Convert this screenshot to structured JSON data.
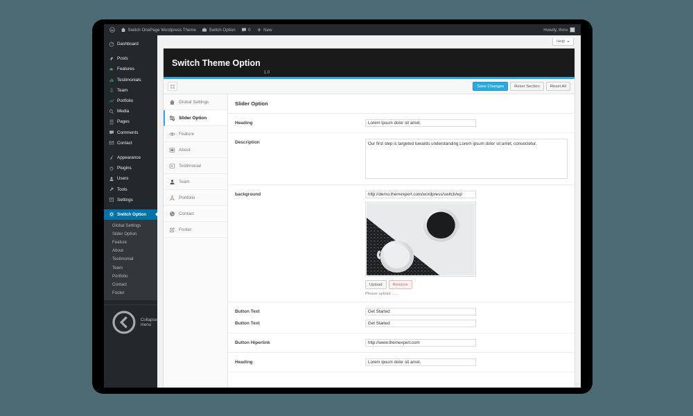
{
  "adminbar": {
    "wp_logo": "wordpress-logo-icon",
    "site_name": "Switch OnePage Wordpress Theme",
    "site_icon": "home-icon",
    "plugin_name": "Switch Option",
    "plugin_icon": "suitcase-icon",
    "comments_icon": "comment-bubble-icon",
    "comments_count": "0",
    "new_label": "New",
    "new_icon": "plus-icon",
    "howdy": "Howdy, thmx",
    "avatar": "user-avatar"
  },
  "adminmenu": {
    "items": [
      {
        "label": "Dashboard",
        "icon": "dashboard-icon",
        "accent": "grey"
      },
      {
        "label": "Posts",
        "icon": "pin-icon",
        "accent": "grey"
      },
      {
        "label": "Features",
        "icon": "cloud-icon",
        "accent": "green"
      },
      {
        "label": "Testimonials",
        "icon": "chart-icon",
        "accent": "green"
      },
      {
        "label": "Team",
        "icon": "anchor-icon",
        "accent": "green"
      },
      {
        "label": "Portfolio",
        "icon": "zigzag-icon",
        "accent": "green"
      },
      {
        "label": "Media",
        "icon": "camera-icon",
        "accent": "grey"
      },
      {
        "label": "Pages",
        "icon": "page-icon",
        "accent": "grey"
      },
      {
        "label": "Comments",
        "icon": "comment-bubble-icon",
        "accent": "grey"
      },
      {
        "label": "Contact",
        "icon": "envelope-icon",
        "accent": "grey"
      },
      {
        "label": "Appearance",
        "icon": "brush-icon",
        "accent": "grey"
      },
      {
        "label": "Plugins",
        "icon": "plug-icon",
        "accent": "grey"
      },
      {
        "label": "Users",
        "icon": "user-icon",
        "accent": "grey"
      },
      {
        "label": "Tools",
        "icon": "wrench-icon",
        "accent": "grey"
      },
      {
        "label": "Settings",
        "icon": "sliders-icon",
        "accent": "grey"
      }
    ],
    "current": {
      "label": "Switch Option",
      "icon": "gear-icon"
    },
    "submenu": [
      "Global Settings",
      "Slider Option",
      "Feature",
      "About",
      "Testimonial",
      "Team",
      "Portfolio",
      "Contact",
      "Footer"
    ],
    "collapse": {
      "label": "Collapse menu",
      "icon": "collapse-icon"
    }
  },
  "help": {
    "label": "Help",
    "icon": "chevron-down-icon"
  },
  "panel": {
    "title": "Switch Theme Option",
    "version": "1.0",
    "accent_color": "#29abe2",
    "menu_toggle_icon": "grid-toggle-icon",
    "buttons": {
      "save": "Save Changes",
      "reset_section": "Reset Section",
      "reset_all": "Reset All"
    }
  },
  "option_tabs": [
    {
      "label": "Global Settings",
      "icon": "home-icon",
      "active": false
    },
    {
      "label": "Slider Option",
      "icon": "sliders-icon",
      "active": true
    },
    {
      "label": "Feature",
      "icon": "eye-icon",
      "active": false
    },
    {
      "label": "About",
      "icon": "card-icon",
      "active": false
    },
    {
      "label": "Testimonial",
      "icon": "quote-list-icon",
      "active": false
    },
    {
      "label": "Team",
      "icon": "user-icon",
      "active": false
    },
    {
      "label": "Portfolio",
      "icon": "compass-icon",
      "active": false
    },
    {
      "label": "Contact",
      "icon": "phone-icon",
      "active": false
    },
    {
      "label": "Footer",
      "icon": "edit-square-icon",
      "active": false
    }
  ],
  "form": {
    "section_title": "Slider Option",
    "heading_label": "Heading",
    "heading_value": "Lorem ipsum dolor sit amet.",
    "description_label": "Description",
    "description_value": "Our first step is targeted towards understanding Lorem ipsum dolor sit amet, consectetur.",
    "background_label": "background",
    "background_value": "http://demo.themexpert.com/wordpress/switch/wp",
    "background_image_alt": "coffee-cups-photo",
    "upload_label": "Upload",
    "remove_label": "Remove",
    "upload_hint": "Please upload .....",
    "button_text_label_1": "Button Text",
    "button_text_value_1": "Get Started",
    "button_text_label_2": "Button Text",
    "button_text_value_2": "Get Started",
    "hyperlink_label": "Button Hiperlink",
    "hyperlink_value": "http://www.themexpert.com",
    "heading2_label": "Heading",
    "heading2_value": "Lorem ipsum dolor sit amet."
  }
}
